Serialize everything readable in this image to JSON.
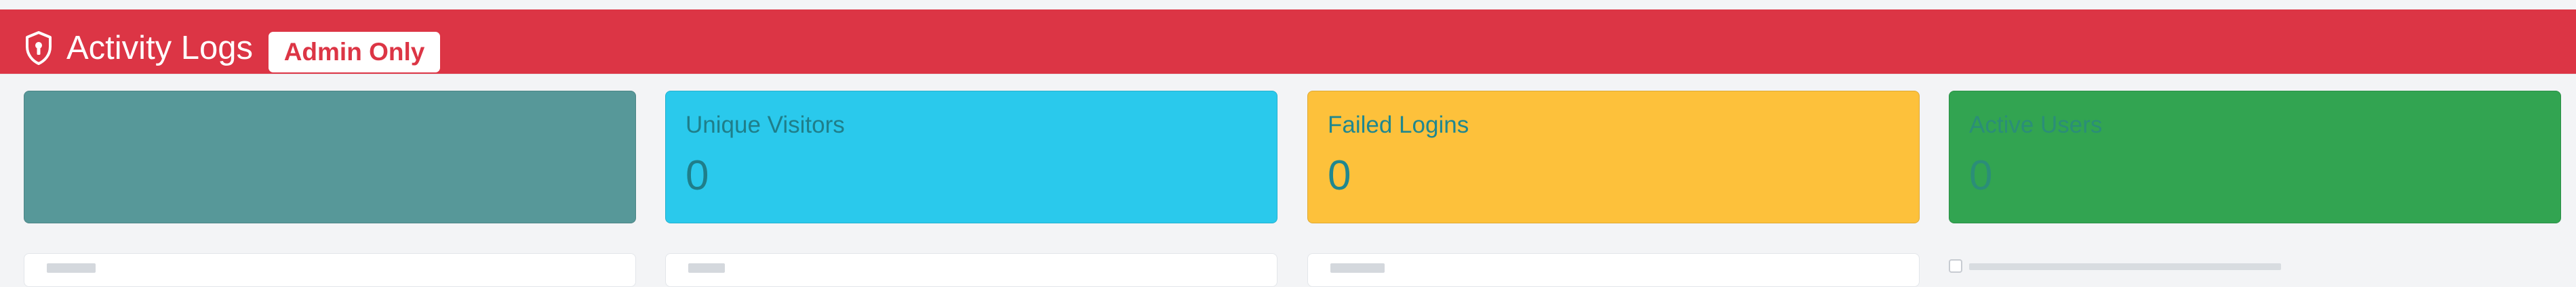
{
  "header": {
    "title": "Activity Logs",
    "badge": "Admin Only",
    "icon": "shield-lock-icon",
    "background_color": "#dc3545"
  },
  "stats": [
    {
      "title": "",
      "value": "",
      "color": "#579899"
    },
    {
      "title": "Unique Visitors",
      "value": "0",
      "color": "#2ac9ec"
    },
    {
      "title": "Failed Logins",
      "value": "0",
      "color": "#fdc13b"
    },
    {
      "title": "Active Users",
      "value": "0",
      "color": "#32a451"
    }
  ],
  "filters": [
    {
      "label": ""
    },
    {
      "label": ""
    },
    {
      "label": ""
    }
  ],
  "checkbox": {
    "label": "",
    "checked": false
  }
}
